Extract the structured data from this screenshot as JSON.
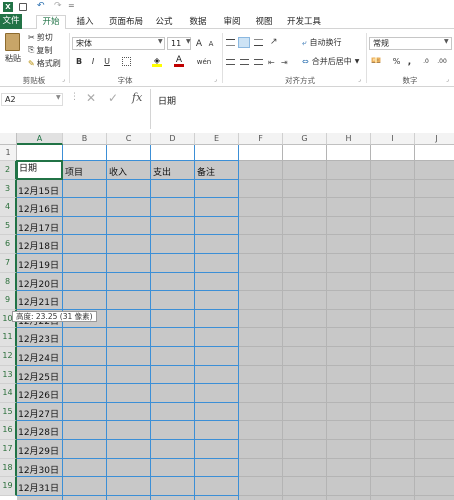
{
  "quick_access": {
    "undo_icon": "undo-icon",
    "redo_icon": "redo-icon",
    "customize": "="
  },
  "tabs": [
    {
      "label": "文件",
      "active": true
    },
    {
      "label": "开始",
      "active": false
    },
    {
      "label": "插入",
      "active": false
    },
    {
      "label": "页面布局",
      "active": false
    },
    {
      "label": "公式",
      "active": false
    },
    {
      "label": "数据",
      "active": false
    },
    {
      "label": "审阅",
      "active": false
    },
    {
      "label": "视图",
      "active": false
    },
    {
      "label": "开发工具",
      "active": false
    }
  ],
  "ribbon": {
    "clipboard": {
      "paste": "粘贴",
      "cut": "剪切",
      "copy": "复制",
      "format_painter": "格式刷",
      "group": "剪贴板"
    },
    "font": {
      "name": "宋体",
      "size": "11",
      "bold": "B",
      "italic": "I",
      "underline": "U",
      "grow": "A",
      "shrink": "A",
      "group": "字体",
      "color_accent": "#c00000",
      "fill_accent": "#ffff00"
    },
    "alignment": {
      "wrap": "自动换行",
      "merge": "合并后居中",
      "group": "对齐方式"
    },
    "number": {
      "format": "常规",
      "group": "数字"
    }
  },
  "formula_bar": {
    "name_box": "A2",
    "formula": "日期",
    "fx": "fx"
  },
  "columns": [
    "A",
    "B",
    "C",
    "D",
    "E",
    "F",
    "G",
    "H",
    "I",
    "J"
  ],
  "rows": [
    "1",
    "2",
    "3",
    "4",
    "5",
    "6",
    "7",
    "8",
    "9",
    "10",
    "11",
    "12",
    "13",
    "14",
    "15",
    "16",
    "17",
    "18",
    "19"
  ],
  "header_row": [
    "日期",
    "项目",
    "收入",
    "支出",
    "备注"
  ],
  "dates": [
    "12月15日",
    "12月16日",
    "12月17日",
    "12月18日",
    "12月19日",
    "12月20日",
    "12月21日",
    "12月22日",
    "12月23日",
    "12月24日",
    "12月25日",
    "12月26日",
    "12月27日",
    "12月28日",
    "12月29日",
    "12月30日",
    "12月31日"
  ],
  "tooltip": "高度: 23.25 (31 像素)",
  "colors": {
    "excel_green": "#217346",
    "grid_fill": "#c8c8c8",
    "border_blue": "#3c8fd6"
  }
}
